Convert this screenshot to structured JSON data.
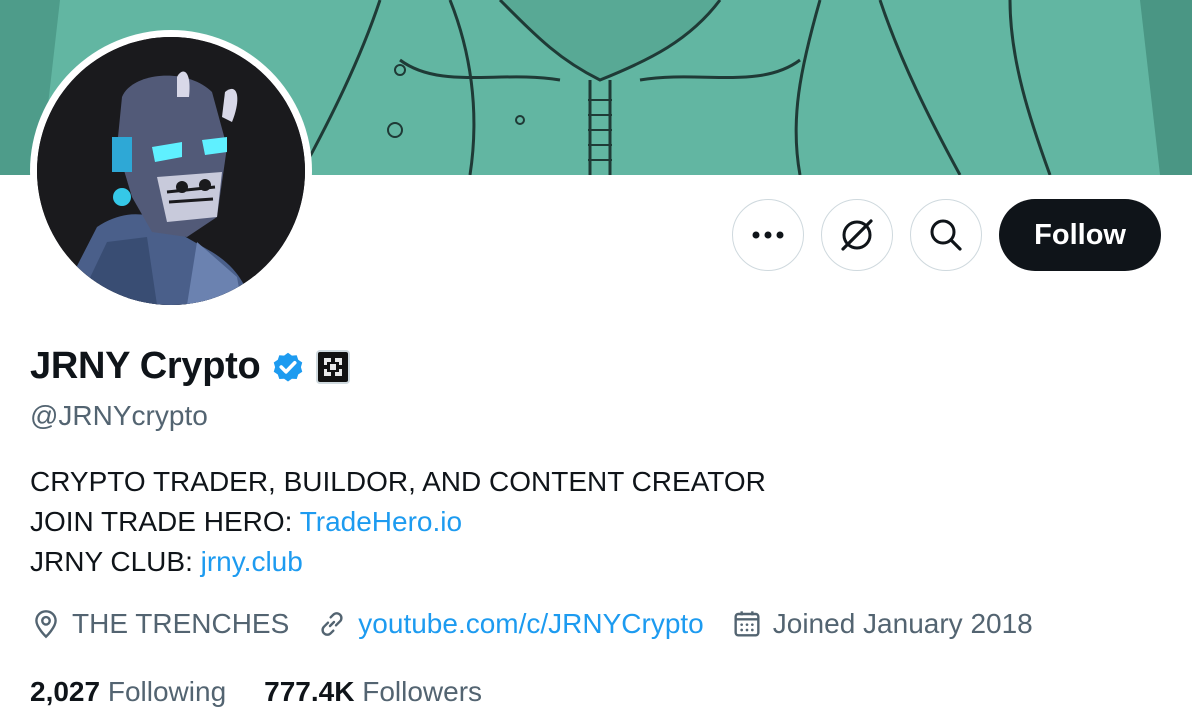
{
  "profile": {
    "display_name": "JRNY Crypto",
    "handle": "@JRNYcrypto",
    "verified_icon": "verified-badge-icon",
    "affiliate_icon": "affiliate-logo-icon"
  },
  "actions": {
    "more_icon": "more-dots-icon",
    "grok_icon": "grok-icon",
    "search_icon": "search-icon",
    "follow_label": "Follow"
  },
  "bio": {
    "line1": "CRYPTO TRADER, BUILDOR, AND CONTENT CREATOR",
    "line2_prefix": "JOIN TRADE HERO: ",
    "line2_link": "TradeHero.io",
    "line3_prefix": "JRNY CLUB: ",
    "line3_link": "jrny.club"
  },
  "meta": {
    "location": "THE TRENCHES",
    "website": "youtube.com/c/JRNYCrypto",
    "joined": "Joined January 2018"
  },
  "stats": {
    "following_count": "2,027",
    "following_label": "Following",
    "followers_count": "777.4K",
    "followers_label": "Followers"
  },
  "colors": {
    "accent": "#1d9bf0",
    "text": "#0f1419",
    "secondary": "#536471",
    "banner": "#5fb39f"
  }
}
